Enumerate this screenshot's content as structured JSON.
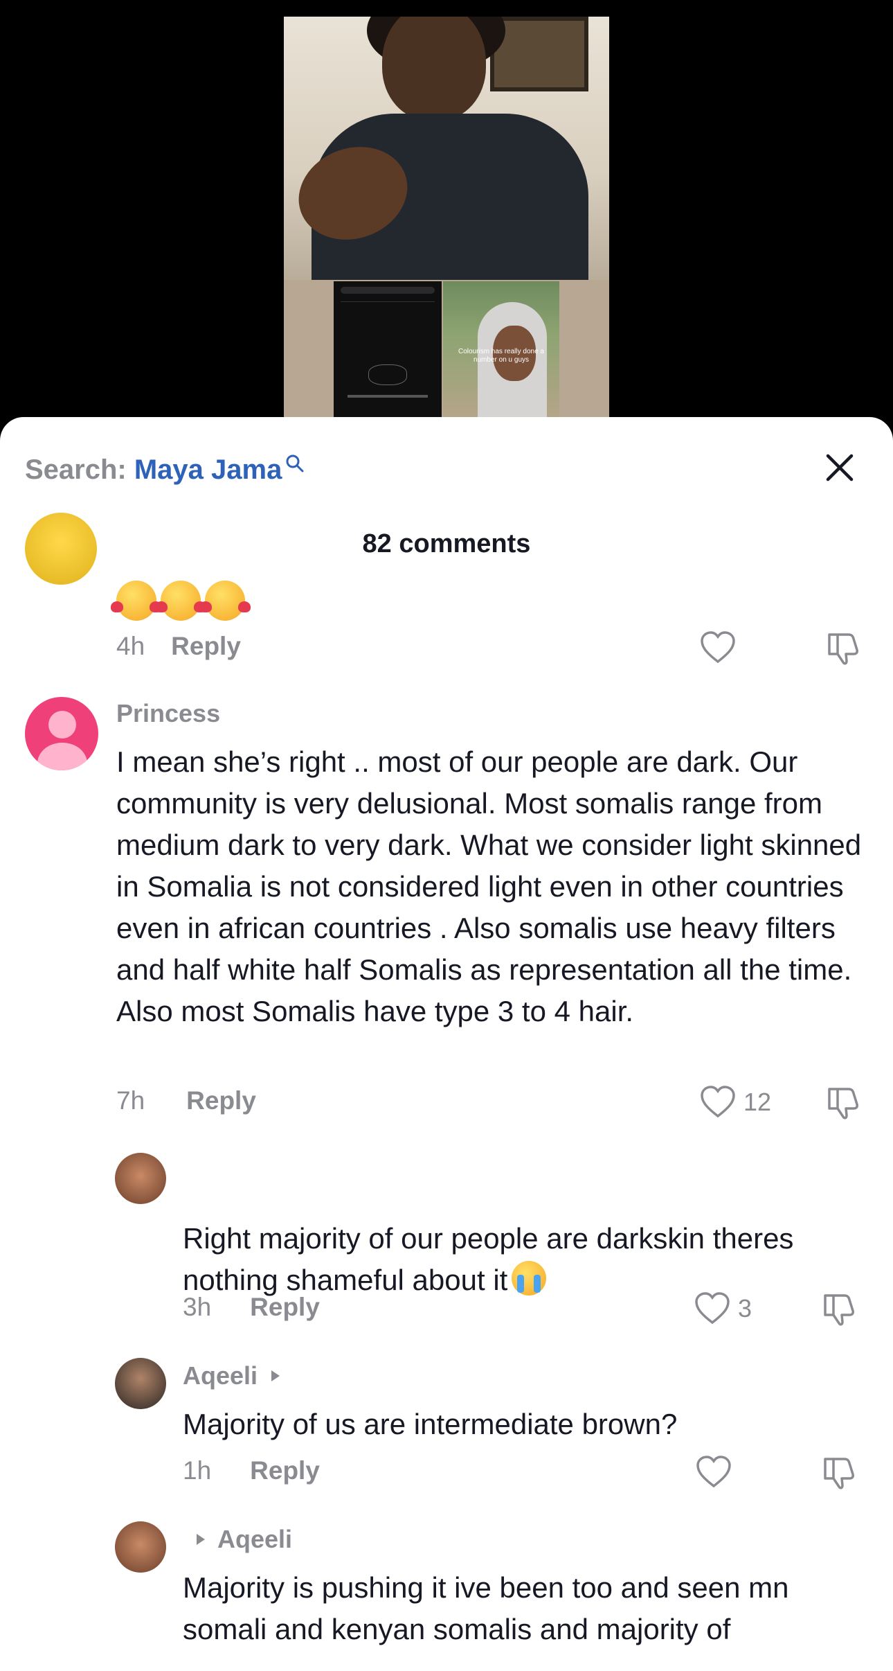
{
  "search": {
    "prefix": "Search: ",
    "query": "Maya Jama"
  },
  "comments_header": {
    "count_label": "82 comments"
  },
  "video": {
    "caption": "Colourism has really done a number on u guys"
  },
  "comments": [
    {
      "partial": true,
      "emoji": [
        "smiling-face-with-hearts",
        "smiling-face-with-hearts",
        "smiling-face-with-hearts"
      ],
      "time": "4h",
      "reply_label": "Reply",
      "likes": ""
    },
    {
      "username": "Princess",
      "text": "I mean she’s right .. most of our people are dark. Our community is very delusional. Most somalis range from medium dark to very dark. What we consider light skinned in Somalia is not considered light even in other countries even in african countries . Also somalis use heavy filters and half white half Somalis as representation all the time. Also most Somalis have type 3 to 4 hair.",
      "time": "7h",
      "reply_label": "Reply",
      "likes": "12"
    }
  ],
  "replies": [
    {
      "username": "",
      "text": "Right majority of our people are darkskin theres nothing shameful about it",
      "emoji": "loudly-crying-face",
      "time": "3h",
      "reply_label": "Reply",
      "likes": "3"
    },
    {
      "username": "Aqeeli",
      "text": "Majority of us are intermediate brown?",
      "time": "1h",
      "reply_label": "Reply",
      "likes": ""
    },
    {
      "username": "Aqeeli",
      "text": "Majority is pushing it ive been too and seen mn somali and kenyan somalis and majority of",
      "time": "",
      "reply_label": "",
      "likes": ""
    }
  ],
  "colors": {
    "accent_blue": "#2e61b8",
    "muted_gray": "#8a8b91",
    "text_dark": "#161823",
    "avatar_pink": "#f0407a"
  }
}
